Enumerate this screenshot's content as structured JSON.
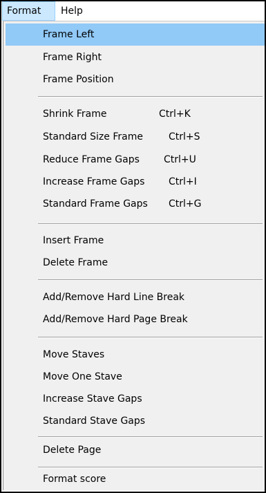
{
  "menubar": {
    "format": "Format",
    "help": "Help"
  },
  "menu": {
    "frame_left": "Frame Left",
    "frame_right": "Frame Right",
    "frame_position": "Frame Position",
    "shrink_frame": "Shrink Frame",
    "shrink_frame_shortcut": "Ctrl+K",
    "standard_size_frame": "Standard Size Frame",
    "standard_size_frame_shortcut": "Ctrl+S",
    "reduce_frame_gaps": "Reduce Frame Gaps",
    "reduce_frame_gaps_shortcut": "Ctrl+U",
    "increase_frame_gaps": "Increase Frame Gaps",
    "increase_frame_gaps_shortcut": "Ctrl+I",
    "standard_frame_gaps": "Standard Frame Gaps",
    "standard_frame_gaps_shortcut": "Ctrl+G",
    "insert_frame": "Insert Frame",
    "delete_frame": "Delete Frame",
    "add_remove_hard_line_break": "Add/Remove Hard Line Break",
    "add_remove_hard_page_break": "Add/Remove Hard Page Break",
    "move_staves": "Move Staves",
    "move_one_stave": "Move One Stave",
    "increase_stave_gaps": "Increase Stave Gaps",
    "standard_stave_gaps": "Standard Stave Gaps",
    "delete_page": "Delete Page",
    "format_score": "Format score"
  },
  "colors": {
    "menubar_active_bg": "#cce8ff",
    "menu_bg": "#f0f0f0",
    "highlight_bg": "#91c9f7"
  }
}
